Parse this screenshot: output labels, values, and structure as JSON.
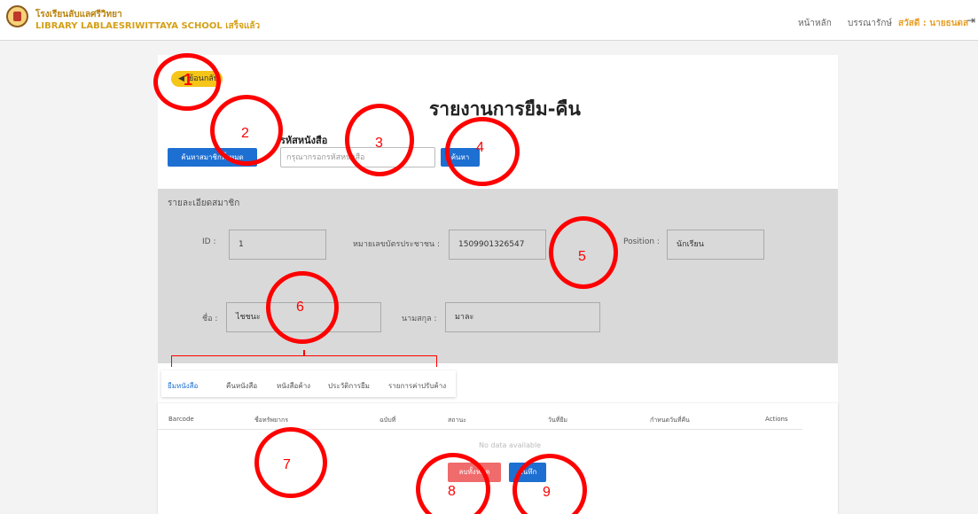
{
  "header": {
    "school_name_th": "โรงเรียนลับแลศรีวิทยา",
    "school_name_en": "LIBRARY LABLAESRIWITTAYA SCHOOL เสร็จแล้ว",
    "nav": {
      "home": "หน้าหลัก",
      "librarian": "บรรณารักษ์",
      "greeting": "สวัสดี : นายธนดล"
    },
    "logout_icon": "logout-icon"
  },
  "toolbar": {
    "back_label": "ย้อนกลับ",
    "back_icon": "back-arrow-icon",
    "page_title": "รายงานการยืม-คืน",
    "search_member_label": "ค้นหาสมาชิกทั้งหมด",
    "book_code_label": "รหัสหนังสือ",
    "book_code_placeholder": "กรุณากรอกรหัสหนังสือ",
    "search_label": "ค้นหา"
  },
  "member": {
    "panel_title": "รายละเอียดสมาชิก",
    "id_label": "ID :",
    "id_value": "1",
    "national_id_label": "หมายเลขบัตรประชาชน :",
    "national_id_value": "1509901326547",
    "position_label": "Position :",
    "position_value": "นักเรียน",
    "first_name_label": "ชื่อ :",
    "first_name_value": "ไชชนะ",
    "last_name_label": "นามสกุล :",
    "last_name_value": "มาละ"
  },
  "tabs": [
    "ยืมหนังสือ",
    "คืนหนังสือ",
    "หนังสือค้าง",
    "ประวัติการยืม",
    "รายการค่าปรับค้าง"
  ],
  "table": {
    "columns": [
      "Barcode",
      "ชื่อทรัพยากร",
      "ฉบับที่",
      "สถานะ",
      "วันที่ยืม",
      "กำหนดวันที่คืน",
      "Actions"
    ],
    "empty_text": "No data available",
    "delete_all_label": "ลบทั้งหมด",
    "save_label": "บันทึก"
  },
  "annotations": [
    "1",
    "2",
    "3",
    "4",
    "5",
    "6",
    "7",
    "8",
    "9"
  ],
  "colors": {
    "accent": "#1e6fd2",
    "danger": "#f06b6b",
    "warning": "#f5c518",
    "annotation": "#ff0000",
    "brand": "#d4a017"
  }
}
